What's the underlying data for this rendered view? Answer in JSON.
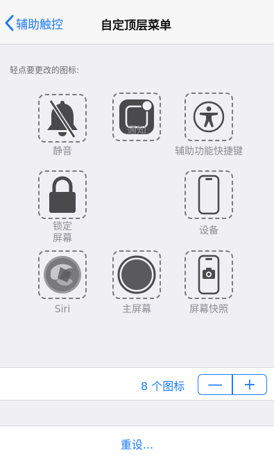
{
  "nav": {
    "back_label": "辅助触控",
    "title": "自定顶层菜单"
  },
  "hint": "轻点要更改的图标:",
  "items": [
    {
      "label": "静音",
      "icon": "mute-bell-icon"
    },
    {
      "label": "通知",
      "icon": "notification-icon"
    },
    {
      "label": "辅助功能快捷键",
      "icon": "accessibility-icon"
    },
    {
      "label": "锁定\n屏幕",
      "icon": "lock-icon"
    },
    {
      "label": "设备",
      "icon": "phone-device-icon"
    },
    {
      "label": "Siri",
      "icon": "siri-icon"
    },
    {
      "label": "主屏幕",
      "icon": "home-button-icon"
    },
    {
      "label": "屏幕快照",
      "icon": "screenshot-icon"
    }
  ],
  "footer": {
    "count_label": "8 个图标",
    "minus": "—",
    "plus": "+",
    "reset_label": "重设..."
  },
  "colors": {
    "accent": "#1f7bf6",
    "icon_dark": "#4a4a4d",
    "background": "#efeff4"
  }
}
